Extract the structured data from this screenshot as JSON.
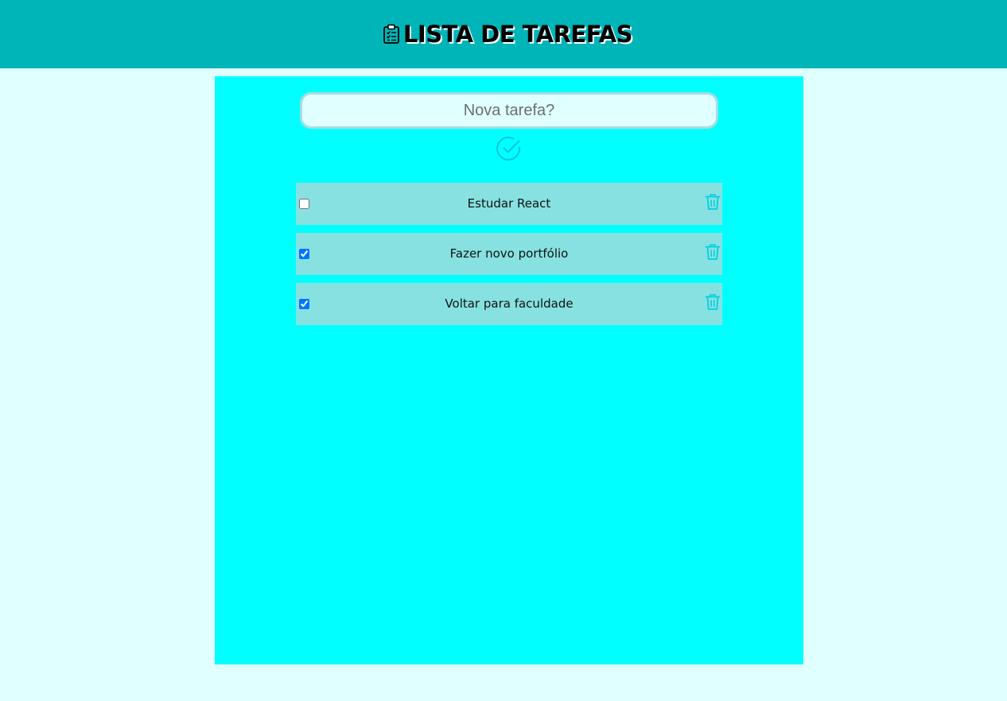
{
  "header": {
    "title": "LISTA DE TAREFAS",
    "icon": "clipboard-list-icon"
  },
  "form": {
    "placeholder": "Nova tarefa?",
    "value": "",
    "add_icon": "check-circle-icon"
  },
  "tasks": [
    {
      "label": "Estudar React",
      "done": false,
      "delete_icon": "trash-icon"
    },
    {
      "label": "Fazer novo portfólio",
      "done": true,
      "delete_icon": "trash-icon"
    },
    {
      "label": "Voltar para faculdade",
      "done": true,
      "delete_icon": "trash-icon"
    }
  ],
  "colors": {
    "header_bg": "#00b5b8",
    "page_bg": "#e0ffff",
    "panel_bg": "#00ffff",
    "task_bg": "#87e1e1",
    "icon_accent": "#00d0e0"
  }
}
